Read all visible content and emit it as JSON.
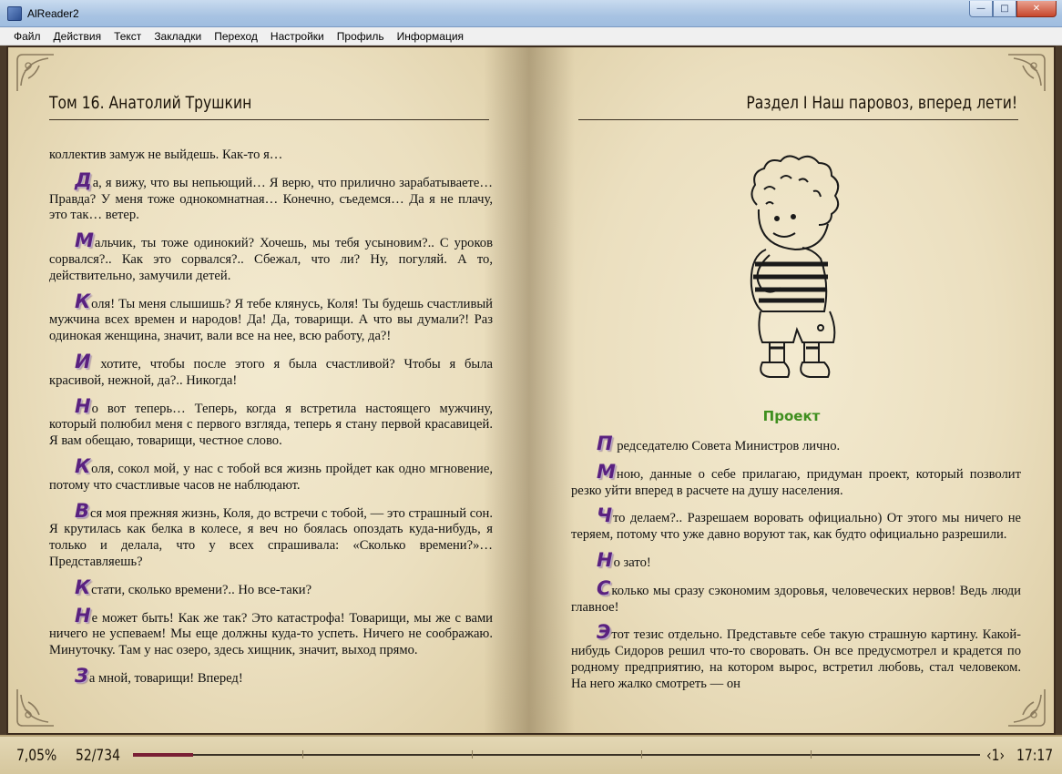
{
  "window": {
    "title": "AlReader2",
    "controls": {
      "minimize": "—",
      "maximize": "□",
      "close": "✕"
    }
  },
  "menu": {
    "items": [
      "Файл",
      "Действия",
      "Текст",
      "Закладки",
      "Переход",
      "Настройки",
      "Профиль",
      "Информация"
    ]
  },
  "left_page": {
    "header": "Том 16. Анатолий Трушкин",
    "paragraphs": [
      {
        "cap": "",
        "text": "коллектив замуж не выйдешь. Как-то я…"
      },
      {
        "cap": "Д",
        "text": "а, я вижу, что вы непьющий… Я верю, что прилично зарабатываете… Правда? У меня тоже однокомнатная… Конечно, съедемся… Да я не плачу, это так… ветер."
      },
      {
        "cap": "М",
        "text": "альчик, ты тоже одинокий? Хочешь, мы тебя усыновим?.. С уроков сорвался?.. Как это сорвался?.. Сбежал, что ли? Ну, погуляй. А то, действительно, замучили детей."
      },
      {
        "cap": "К",
        "text": "оля! Ты меня слышишь? Я тебе клянусь, Коля! Ты будешь счастливый мужчина всех времен и народов! Да! Да, товарищи. А что вы думали?! Раз одинокая женщина, значит, вали все на нее, всю работу, да?!"
      },
      {
        "cap": "И",
        "text": " хотите, чтобы после этого я была счастливой? Чтобы я была красивой, нежной, да?.. Никогда!"
      },
      {
        "cap": "Н",
        "text": "о вот теперь… Теперь, когда я встретила настоящего мужчину, который полюбил меня с первого взгляда, теперь я стану первой красавицей. Я вам обещаю, товарищи, честное слово."
      },
      {
        "cap": "К",
        "text": "оля, сокол мой, у нас с тобой вся жизнь пройдет как одно мгновение, потому что счастливые часов не наблюдают."
      },
      {
        "cap": "В",
        "text": "ся моя прежняя жизнь, Коля, до встречи с тобой, — это страшный сон. Я крутилась как белка в колесе, я веч но боялась опоздать куда-нибудь, я только и делала, что у всех спрашивала: «Сколько времени?»… Представляешь?"
      },
      {
        "cap": "К",
        "text": "стати, сколько времени?.. Но все-таки?"
      },
      {
        "cap": "Н",
        "text": "е может быть! Как же так? Это катастрофа! Товарищи, мы же с вами ничего не успеваем! Мы еще должны куда-то успеть. Ничего не соображаю. Минуточку. Там у нас озеро, здесь хищник, значит, выход прямо."
      },
      {
        "cap": "З",
        "text": "а мной, товарищи! Вперед!"
      }
    ]
  },
  "right_page": {
    "header": "Раздел I Наш паровоз, вперед лети!",
    "section_title": "Проект",
    "paragraphs": [
      {
        "cap": "П",
        "text": " редседателю Совета Министров лично."
      },
      {
        "cap": "М",
        "text": "ною, данные о себе прилагаю, придуман проект, который позволит резко уйти вперед в расчете на душу населения."
      },
      {
        "cap": "Ч",
        "text": "то делаем?.. Разрешаем воровать официально) От этого мы ничего не теряем, потому что уже давно воруют так, как будто официально разрешили."
      },
      {
        "cap": "Н",
        "text": "о зато!"
      },
      {
        "cap": "С",
        "text": "колько мы сразу сэкономим здоровья, человеческих нервов! Ведь люди главное!"
      },
      {
        "cap": "Э",
        "text": "тот тезис отдельно. Представьте себе такую страшную картину. Какой-нибудь Сидоров решил что-то своровать. Он все предусмотрел и крадется по родному предприятию, на котором вырос, встретил любовь, стал человеком. На него жалко смотреть — он"
      }
    ]
  },
  "status": {
    "percent": "7,05%",
    "pages": "52/734",
    "progress": 0.0705,
    "nav": "‹1›",
    "clock": "17:17"
  },
  "colors": {
    "dropcap": "#5a2180",
    "section_title": "#3f8f1f",
    "progress_fill": "#7a1f34"
  }
}
